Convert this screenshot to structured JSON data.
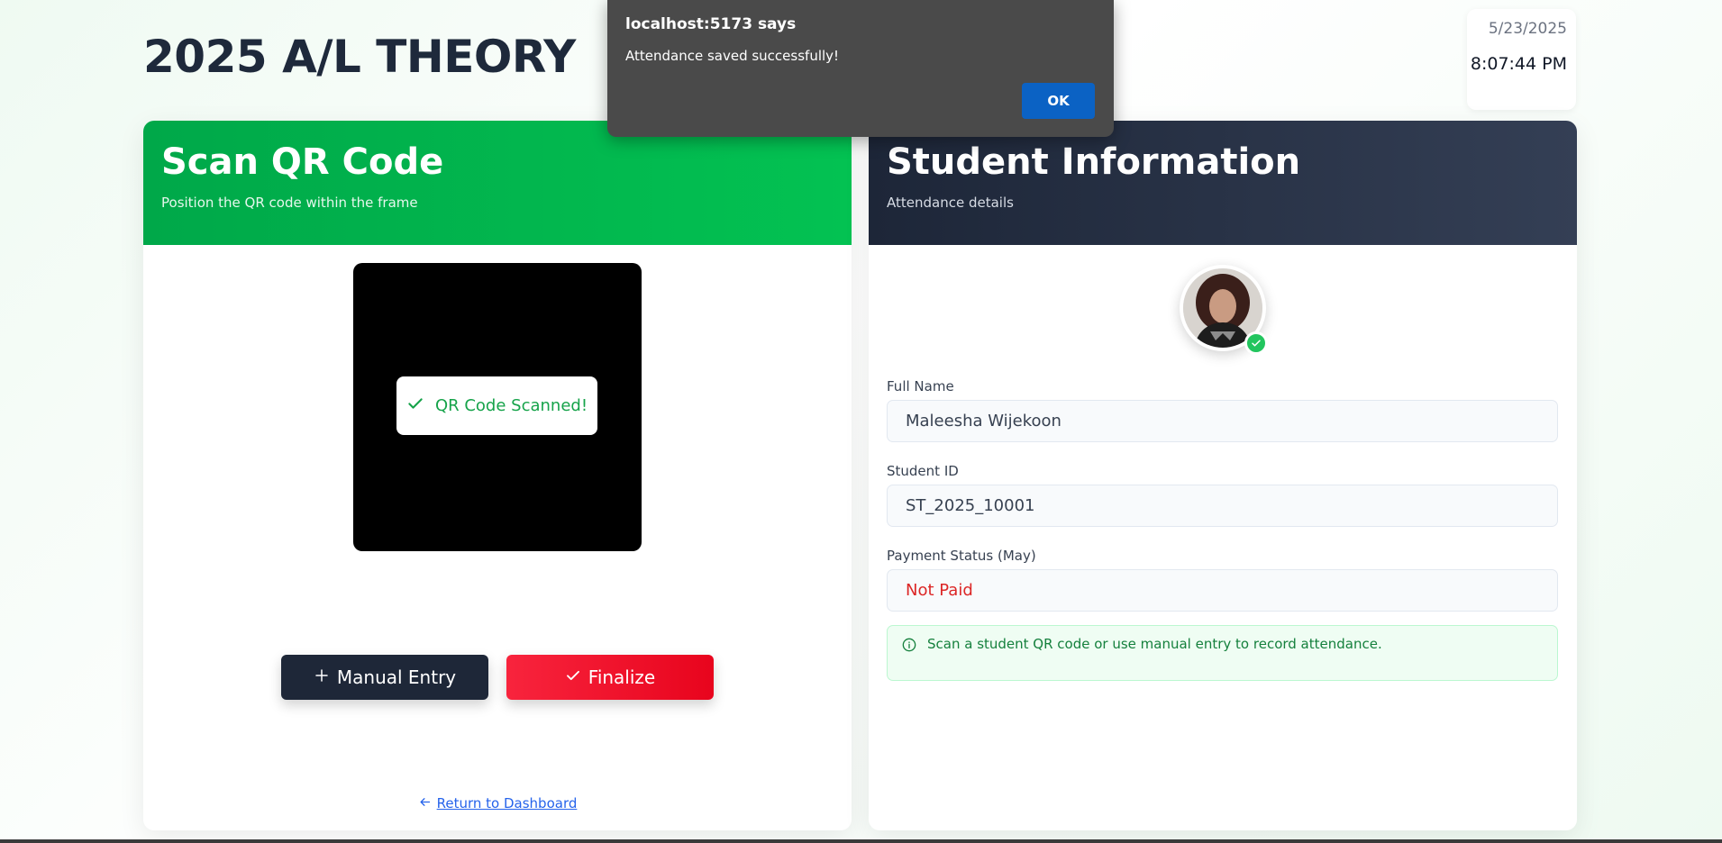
{
  "page": {
    "title": "2025 A/L THEORY"
  },
  "clock": {
    "date": "5/23/2025",
    "time": "8:07:44 PM"
  },
  "scanner_panel": {
    "title": "Scan QR Code",
    "subtitle": "Position the QR code within the frame",
    "scan_status": "QR Code Scanned!",
    "manual_entry_label": "Manual Entry",
    "finalize_label": "Finalize",
    "return_link": "Return to Dashboard"
  },
  "student_panel": {
    "title": "Student Information",
    "subtitle": "Attendance details",
    "fields": [
      {
        "label": "Full Name",
        "value": "Maleesha Wijekoon"
      },
      {
        "label": "Student ID",
        "value": "ST_2025_10001"
      },
      {
        "label": "Payment Status (May)",
        "value": "Not Paid"
      }
    ],
    "info_message": "Scan a student QR code or use manual entry to record attendance."
  },
  "alert_dialog": {
    "title": "localhost:5173 says",
    "message": "Attendance saved successfully!",
    "ok_label": "OK"
  },
  "colors": {
    "scan_header": "#00a849",
    "student_header": "#1d2638",
    "finalize": "#f8243d",
    "manual": "#1e2738",
    "success": "#16a34a",
    "unpaid": "#dc2626"
  }
}
